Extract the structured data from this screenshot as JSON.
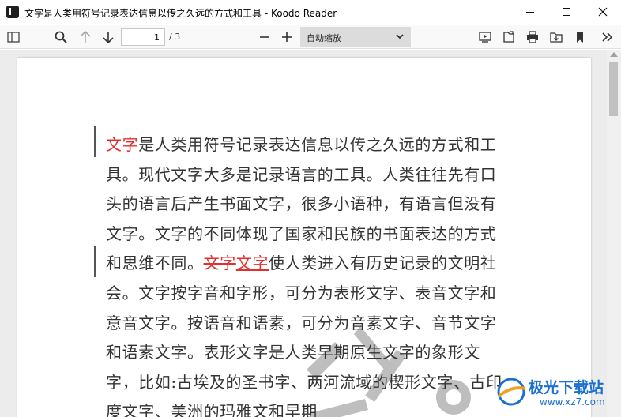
{
  "window": {
    "title": "文字是人类用符号记录表达信息以传之久远的方式和工具 - Koodo Reader",
    "app_icon": "koodo-reader-icon",
    "controls": [
      "minimize-icon",
      "maximize-icon",
      "close-icon"
    ]
  },
  "toolbar": {
    "left_icons": [
      "sidebar-toggle-icon",
      "search-icon",
      "arrow-up-icon",
      "arrow-down-icon"
    ],
    "page_current": "1",
    "page_total": "/ 3",
    "zoom_out_icon": "minus-icon",
    "zoom_in_icon": "plus-icon",
    "zoom_value": "自动缩放",
    "right_icons": [
      "presentation-icon",
      "open-file-icon",
      "print-icon",
      "download-icon",
      "bookmark-icon",
      "more-chevron-icon"
    ]
  },
  "document": {
    "segments": [
      {
        "text": "文字",
        "style": "red"
      },
      {
        "text": "是人类用符号记录表达信息以传之久远的方式和工具。现代文字大多是记录语言的工具。人类往往先有口头的语言后产生书面文字，很多小语种，有语言但没有文字。文字的不同体现了国家和民族的书面表达的方式和思维不同。",
        "style": "normal"
      },
      {
        "text": "文字",
        "style": "red-strike"
      },
      {
        "text": "文字",
        "style": "red-underline"
      },
      {
        "text": "使人类进入有历史记录的文明社会。文字按字音和字形，可分为表形文字、表音文字和意音文字。按语音和语素，可分为音素文字、音节文字和语素文字。表形文字是人类早期原生文字的象形文字，比如:古埃及的圣书字、两河流域的楔形文字、古印度文字、美洲的玛雅文和早期",
        "style": "normal"
      }
    ],
    "watermark": "文字"
  },
  "brand_watermark": {
    "name": "极光下载站",
    "url": "www.xz7.com"
  },
  "colors": {
    "annotation_red": "#e03030",
    "text": "#333333",
    "brand_blue": "#1a6fd1"
  }
}
